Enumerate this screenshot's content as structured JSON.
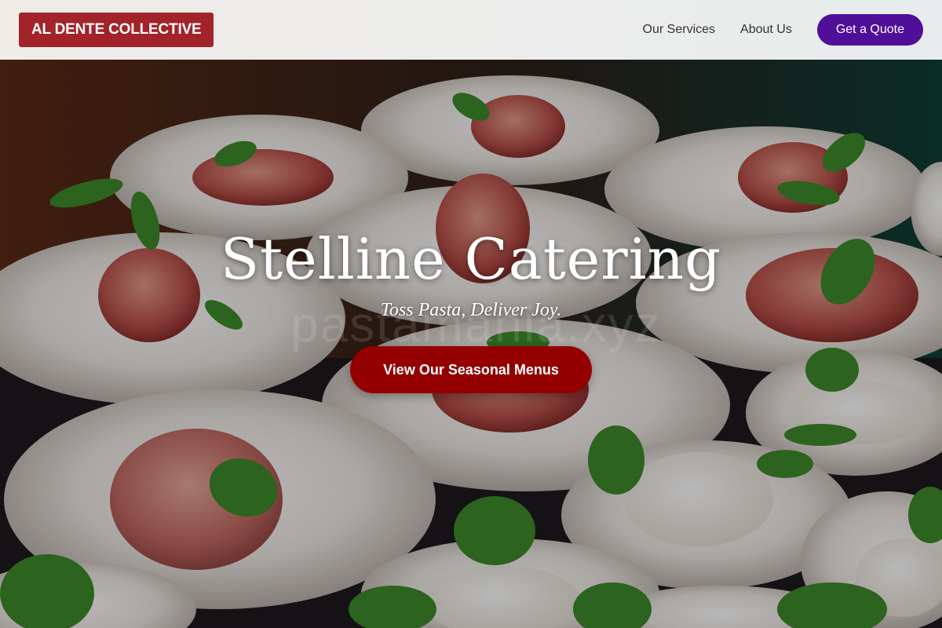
{
  "header": {
    "logo": "AL DENTE COLLECTIVE",
    "nav": [
      {
        "label": "Our Services"
      },
      {
        "label": "About Us"
      }
    ],
    "cta_label": "Get a Quote"
  },
  "hero": {
    "title": "Stelline Catering",
    "tagline": "Toss Pasta, Deliver Joy.",
    "watermark": "pastamania.xyz",
    "button_label": "View Our Seasonal Menus",
    "image_description_icon": "catering-plates-photo"
  },
  "colors": {
    "logo_bg": "#a3232a",
    "cta_bg": "#4f0f99",
    "hero_button_bg": "#940000"
  }
}
